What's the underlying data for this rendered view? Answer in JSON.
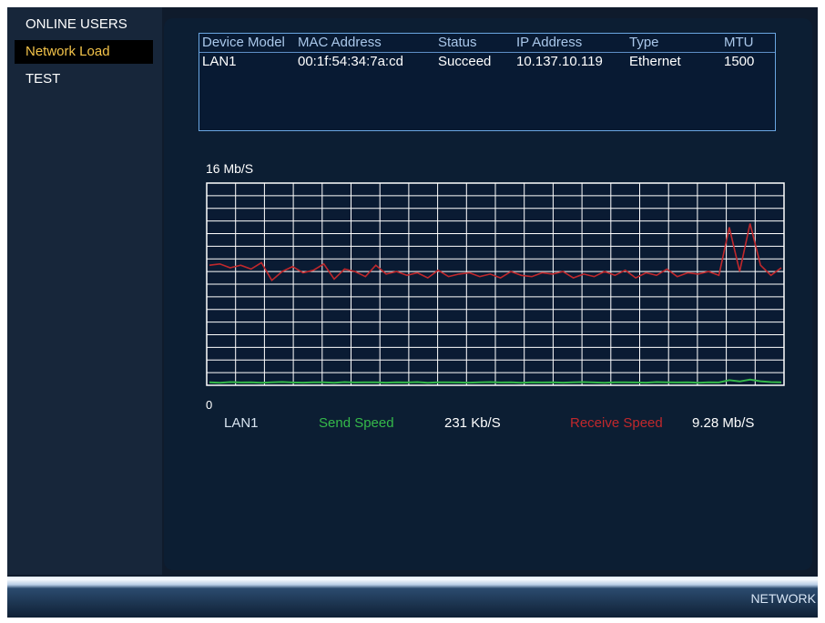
{
  "sidebar": {
    "items": [
      {
        "label": "ONLINE USERS",
        "active": false
      },
      {
        "label": "Network Load",
        "active": true
      },
      {
        "label": "TEST",
        "active": false
      }
    ]
  },
  "adapter_table": {
    "headers": [
      "Device Model",
      "MAC Address",
      "Status",
      "IP Address",
      "Type",
      "MTU"
    ],
    "rows": [
      [
        "LAN1",
        "00:1f:54:34:7a:cd",
        "Succeed",
        "10.137.10.119",
        "Ethernet",
        "1500"
      ]
    ]
  },
  "load_chart": {
    "scale_max": "16 Mb/S",
    "scale_min": "0",
    "colors": {
      "send": "#35b94a",
      "receive": "#c0282c",
      "grid": "#ffffff"
    }
  },
  "chart_data": {
    "type": "line",
    "ylim": [
      0,
      16
    ],
    "grid": true,
    "series": [
      {
        "name": "Receive Speed",
        "values": [
          9.5,
          9.6,
          9.3,
          9.5,
          9.2,
          9.7,
          8.3,
          9.0,
          9.4,
          8.9,
          9.1,
          9.6,
          8.4,
          9.2,
          9.0,
          8.6,
          9.5,
          8.8,
          9.0,
          8.7,
          8.9,
          8.5,
          9.1,
          8.6,
          8.8,
          8.9,
          8.6,
          8.8,
          8.5,
          9.0,
          8.7,
          8.6,
          8.9,
          8.8,
          9.0,
          8.5,
          8.8,
          8.6,
          9.0,
          8.7,
          9.1,
          8.5,
          8.9,
          8.7,
          9.2,
          8.6,
          8.9,
          8.8,
          9.0,
          8.7,
          12.5,
          9.0,
          12.8,
          9.5,
          8.7,
          9.3
        ]
      },
      {
        "name": "Send Speed",
        "values": [
          0.23,
          0.2,
          0.25,
          0.22,
          0.24,
          0.2,
          0.23,
          0.26,
          0.22,
          0.21,
          0.24,
          0.23,
          0.2,
          0.25,
          0.22,
          0.23,
          0.24,
          0.21,
          0.23,
          0.22,
          0.25,
          0.2,
          0.23,
          0.24,
          0.22,
          0.21,
          0.23,
          0.25,
          0.22,
          0.24,
          0.2,
          0.23,
          0.22,
          0.24,
          0.21,
          0.23,
          0.25,
          0.22,
          0.2,
          0.24,
          0.23,
          0.22,
          0.21,
          0.25,
          0.23,
          0.22,
          0.24,
          0.2,
          0.23,
          0.22,
          0.4,
          0.3,
          0.45,
          0.32,
          0.25,
          0.23
        ]
      }
    ]
  },
  "legend": {
    "interface": "LAN1",
    "send_label": "Send Speed",
    "send_value": "231 Kb/S",
    "receive_label": "Receive Speed",
    "receive_value": "9.28 Mb/S"
  },
  "bottombar": {
    "label": "NETWORK"
  }
}
